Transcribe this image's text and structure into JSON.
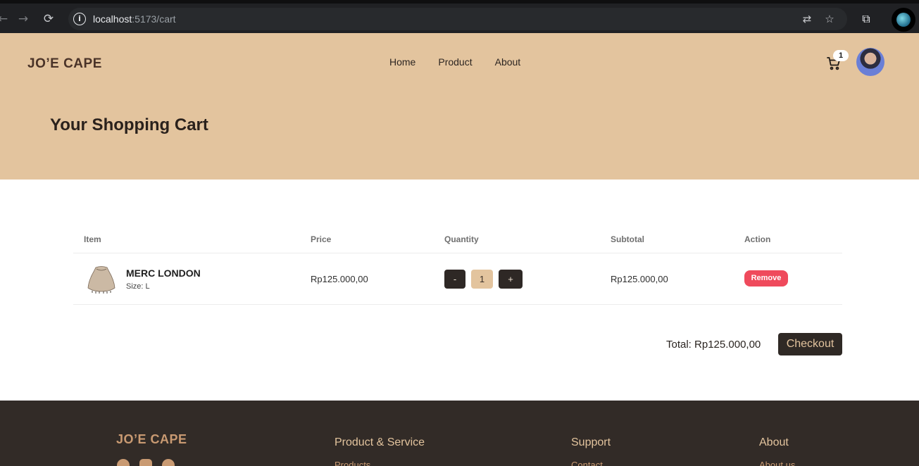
{
  "browser": {
    "url_host": "localhost",
    "url_path": ":5173/cart"
  },
  "header": {
    "brand": "JO’E CAPE",
    "nav": [
      "Home",
      "Product",
      "About"
    ],
    "cart_count": "1"
  },
  "page": {
    "title": "Your Shopping Cart"
  },
  "cart": {
    "columns": [
      "Item",
      "Price",
      "Quantity",
      "Subtotal",
      "Action"
    ],
    "items": [
      {
        "name": "MERC LONDON",
        "size": "Size: L",
        "price": "Rp125.000,00",
        "decrement": "-",
        "quantity": "1",
        "increment": "+",
        "subtotal": "Rp125.000,00",
        "action": "Remove"
      }
    ],
    "total_label": "Total:",
    "total_value": "Rp125.000,00",
    "checkout": "Checkout"
  },
  "footer": {
    "brand": "JO’E CAPE",
    "columns": [
      {
        "title": "Product & Service",
        "link": "Products"
      },
      {
        "title": "Support",
        "link": "Contact"
      },
      {
        "title": "About",
        "link": "About us"
      }
    ]
  },
  "colors": {
    "hero_bg": "#e3c49e",
    "footer_bg": "#322b27",
    "dark_button": "#2f2925",
    "remove_button": "#ef4a5c"
  }
}
